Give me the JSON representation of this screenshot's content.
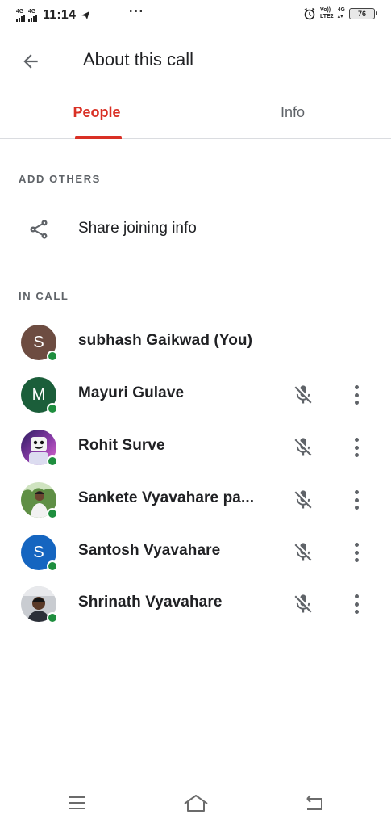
{
  "status_bar": {
    "sim1_label": "4G",
    "sim2_label": "4G",
    "time": "11:14",
    "more_indicator": "···",
    "volte_top": "Vo))",
    "volte_bottom": "LTE2",
    "net_top": "4G",
    "net_bottom": "▴▾",
    "battery": "76"
  },
  "app_bar": {
    "title": "About this call",
    "back_icon": "arrow-back-icon"
  },
  "tabs": [
    {
      "label": "People",
      "selected": true
    },
    {
      "label": "Info",
      "selected": false
    }
  ],
  "sections": {
    "add_others": "ADD OTHERS",
    "in_call": "IN CALL"
  },
  "share": {
    "label": "Share joining info",
    "icon": "share-icon"
  },
  "participants": [
    {
      "name": "subhash Gaikwad (You)",
      "initial": "S",
      "avatar_color": "#6d4c41",
      "avatar_kind": "initial",
      "is_you": true
    },
    {
      "name": "Mayuri Gulave",
      "initial": "M",
      "avatar_color": "#1b5e3a",
      "avatar_kind": "initial",
      "is_you": false
    },
    {
      "name": "Rohit Surve",
      "initial": "",
      "avatar_color": "#3b2a6e",
      "avatar_kind": "photo",
      "is_you": false
    },
    {
      "name": "Sankete Vyavahare pa...",
      "initial": "",
      "avatar_color": "#7fa66a",
      "avatar_kind": "photo",
      "is_you": false
    },
    {
      "name": "Santosh Vyavahare",
      "initial": "S",
      "avatar_color": "#1565c0",
      "avatar_kind": "initial",
      "is_you": false
    },
    {
      "name": "Shrinath Vyavahare",
      "initial": "",
      "avatar_color": "#5a5e66",
      "avatar_kind": "photo",
      "is_you": false
    }
  ],
  "colors": {
    "accent": "#d93025",
    "presence": "#1e8e3e",
    "icon_gray": "#5f6368",
    "divider": "#dadce0"
  },
  "nav": {
    "menu_icon": "menu-icon",
    "home_icon": "home-icon",
    "back_icon": "back-icon"
  }
}
